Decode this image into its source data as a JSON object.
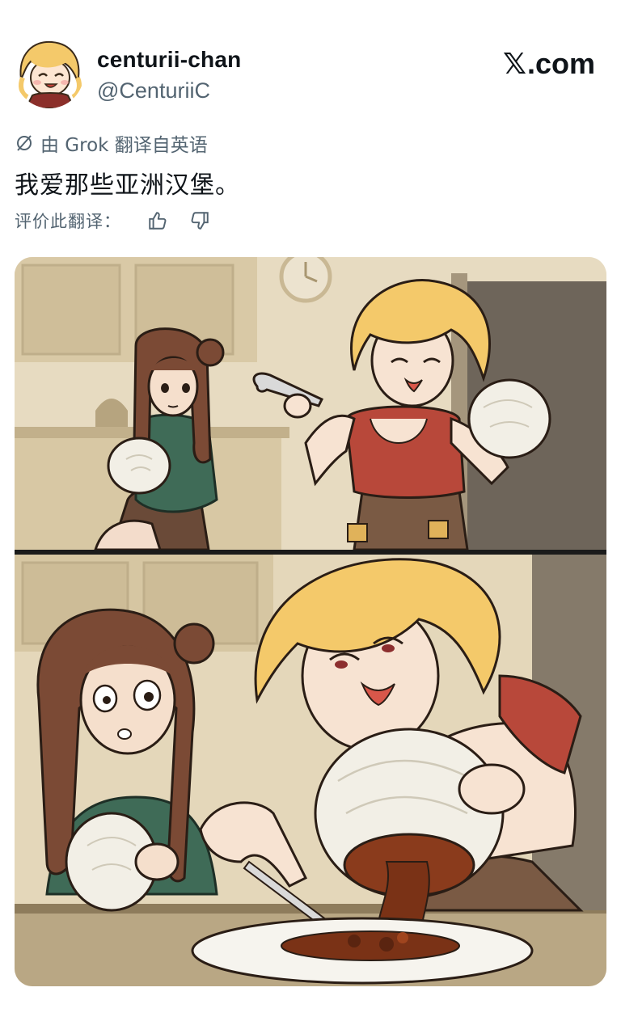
{
  "author": {
    "display_name": "centurii-chan",
    "handle": "@CenturiiC"
  },
  "brand": {
    "x_glyph": "𝕏",
    "domain": ".com"
  },
  "translation": {
    "source_note": "由 Grok 翻译自英语",
    "text": "我爱那些亚洲汉堡。",
    "rate_label": "评价此翻译："
  },
  "icons": {
    "translate": "translate-icon",
    "thumbs_up": "thumbs-up-icon",
    "thumbs_down": "thumbs-down-icon"
  },
  "colors": {
    "text_primary": "#0f1419",
    "text_secondary": "#536471",
    "blonde_hair": "#f4c96a",
    "brown_hair": "#7b4a35",
    "red_dress": "#b8483a",
    "green_shirt": "#3f6b57",
    "bun_white": "#f2efe6",
    "background_beige": "#e9dcc0"
  }
}
